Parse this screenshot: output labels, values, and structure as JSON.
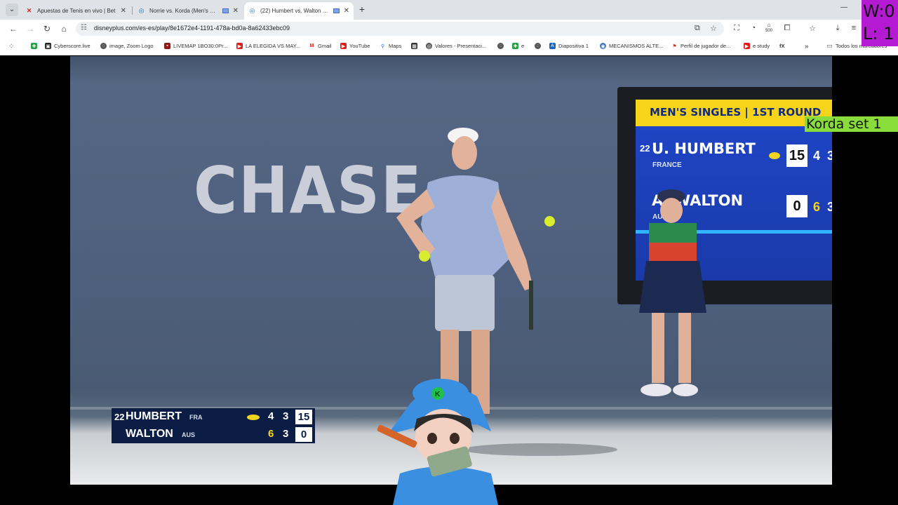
{
  "tabs": [
    {
      "title": "Apuestas de Tenis en vivo | Bet",
      "active": false
    },
    {
      "title": "Norrie vs. Korda (Men's First",
      "active": false
    },
    {
      "title": "(22) Humbert vs. Walton (M",
      "active": true
    }
  ],
  "address_bar": {
    "url": "disneyplus.com/es-es/play/8e1672e4-1191-478a-bd0a-8a62433ebc09"
  },
  "extension_badge": "500",
  "bookmarks": [
    "Cyberscore.live",
    "image, Zoom Logo",
    "LIVEMAP 1BO30:0Pr...",
    "LA ELEGIDA VS MAY...",
    "Gmail",
    "YouTube",
    "Maps",
    "Valores - Presentaci...",
    "e",
    "Diapositiva 1",
    "MECANISMOS ALTE...",
    "Perfil de jugador de...",
    "e study",
    "fX"
  ],
  "bookmarks_folder": "Todos los marcadores",
  "stadium_board": {
    "header": "MEN'S SINGLES | 1ST ROUND",
    "p1_seed": "22",
    "p1_name": "U. HUMBERT",
    "p1_country": "FRANCE",
    "p1_points": "15",
    "p1_games": [
      "4",
      "3"
    ],
    "p2_name": "A. WALTON",
    "p2_country": "AUS",
    "p2_points": "0",
    "p2_games": [
      "6",
      "3"
    ]
  },
  "video": {
    "sponsor": "CHASE"
  },
  "scorebug": {
    "p1_seed": "22",
    "p1_name": "HUMBERT",
    "p1_country": "FRA",
    "p1_sets": [
      "4",
      "3"
    ],
    "p1_points": "15",
    "p2_name": "WALTON",
    "p2_country": "AUS",
    "p2_sets": [
      "6",
      "3"
    ],
    "p2_points": "0"
  },
  "overlay": {
    "wins": "W:0",
    "losses": "L: 1",
    "note": "Korda set 1"
  },
  "colors": {
    "accent_yellow": "#f5d419",
    "board_blue": "#2046c9",
    "overlay_purple": "#b51ad3",
    "overlay_green": "#88dc3c"
  }
}
